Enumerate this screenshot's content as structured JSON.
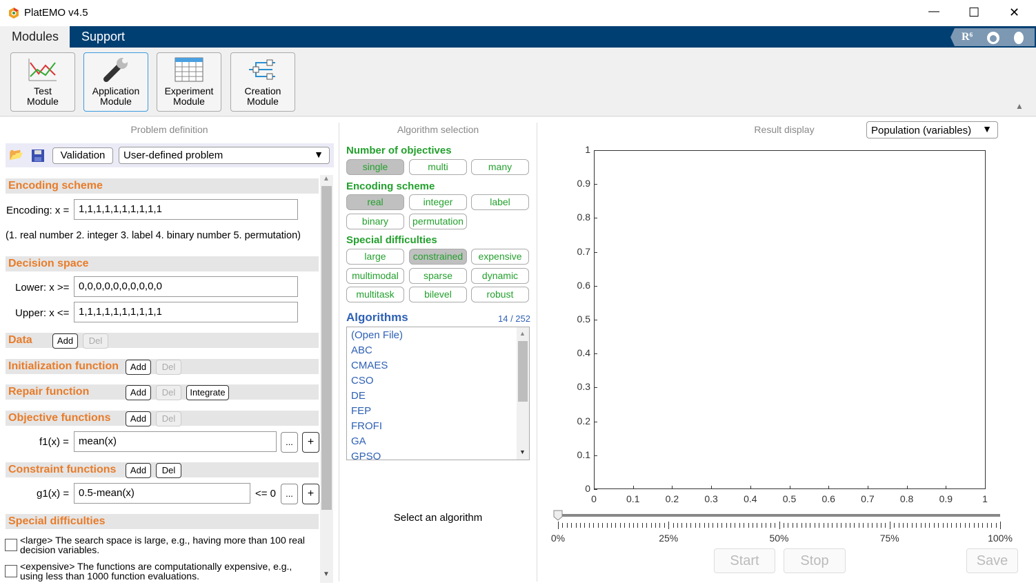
{
  "window": {
    "title": "PlatEMO v4.5",
    "controls": {
      "minimize": "—",
      "maximize": "☐",
      "close": "✕"
    }
  },
  "menu": {
    "tabs": [
      {
        "label": "Modules"
      },
      {
        "label": "Support"
      }
    ],
    "right_icons": [
      "researchgate-icon",
      "github-icon",
      "qq-icon"
    ],
    "rg_label": "R⁶"
  },
  "ribbon": {
    "buttons": [
      {
        "line1": "Test",
        "line2": "Module"
      },
      {
        "line1": "Application",
        "line2": "Module"
      },
      {
        "line1": "Experiment",
        "line2": "Module"
      },
      {
        "line1": "Creation",
        "line2": "Module"
      }
    ]
  },
  "problem": {
    "title": "Problem definition",
    "validation": "Validation",
    "problem_select": "User-defined problem",
    "encoding": {
      "title": "Encoding scheme",
      "label": "Encoding: x =",
      "value": "1,1,1,1,1,1,1,1,1,1",
      "hint": "(1. real number 2. integer 3. label 4. binary number 5. permutation)"
    },
    "decision": {
      "title": "Decision space",
      "lower_label": "Lower: x >=",
      "lower": "0,0,0,0,0,0,0,0,0,0",
      "upper_label": "Upper: x <=",
      "upper": "1,1,1,1,1,1,1,1,1,1"
    },
    "data": {
      "title": "Data"
    },
    "init": {
      "title": "Initialization function"
    },
    "repair": {
      "title": "Repair function",
      "integrate": "Integrate"
    },
    "objective": {
      "title": "Objective functions",
      "label": "f1(x) =",
      "value": "mean(x)"
    },
    "constraint": {
      "title": "Constraint functions",
      "label": "g1(x) =",
      "value": "0.5-mean(x)",
      "suffix": "<= 0"
    },
    "special": {
      "title": "Special difficulties",
      "items": [
        {
          "text": "<large> The search space is large, e.g., having more than 100 real decision variables.",
          "checked": false
        },
        {
          "text": "<expensive> The functions are computationally expensive, e.g., using less than 1000 function evaluations.",
          "checked": false
        }
      ]
    },
    "add": "Add",
    "del": "Del",
    "more": "...",
    "plus": "+"
  },
  "algorithm": {
    "title": "Algorithm selection",
    "objectives": {
      "title": "Number of objectives",
      "options": [
        {
          "label": "single",
          "on": true
        },
        {
          "label": "multi",
          "on": false
        },
        {
          "label": "many",
          "on": false
        }
      ]
    },
    "encoding": {
      "title": "Encoding scheme",
      "options": [
        {
          "label": "real",
          "on": true
        },
        {
          "label": "integer",
          "on": false
        },
        {
          "label": "label",
          "on": false
        },
        {
          "label": "binary",
          "on": false
        },
        {
          "label": "permutation",
          "on": false
        }
      ]
    },
    "special": {
      "title": "Special difficulties",
      "options": [
        {
          "label": "large",
          "on": false
        },
        {
          "label": "constrained",
          "on": true
        },
        {
          "label": "expensive",
          "on": false
        },
        {
          "label": "multimodal",
          "on": false
        },
        {
          "label": "sparse",
          "on": false
        },
        {
          "label": "dynamic",
          "on": false
        },
        {
          "label": "multitask",
          "on": false
        },
        {
          "label": "bilevel",
          "on": false
        },
        {
          "label": "robust",
          "on": false
        }
      ]
    },
    "list_title": "Algorithms",
    "count": "14 / 252",
    "list": [
      "(Open File)",
      "ABC",
      "CMAES",
      "CSO",
      "DE",
      "FEP",
      "FROFI",
      "GA",
      "GPSO"
    ],
    "status": "Select an algorithm"
  },
  "result": {
    "title": "Result display",
    "display_select": "Population (variables)",
    "xticks": [
      "0",
      "0.1",
      "0.2",
      "0.3",
      "0.4",
      "0.5",
      "0.6",
      "0.7",
      "0.8",
      "0.9",
      "1"
    ],
    "yticks": [
      "0",
      "0.1",
      "0.2",
      "0.3",
      "0.4",
      "0.5",
      "0.6",
      "0.7",
      "0.8",
      "0.9",
      "1"
    ],
    "slider": {
      "value_percent": 0,
      "labels": [
        "0%",
        "25%",
        "50%",
        "75%",
        "100%"
      ]
    },
    "start": "Start",
    "stop": "Stop",
    "save": "Save"
  }
}
